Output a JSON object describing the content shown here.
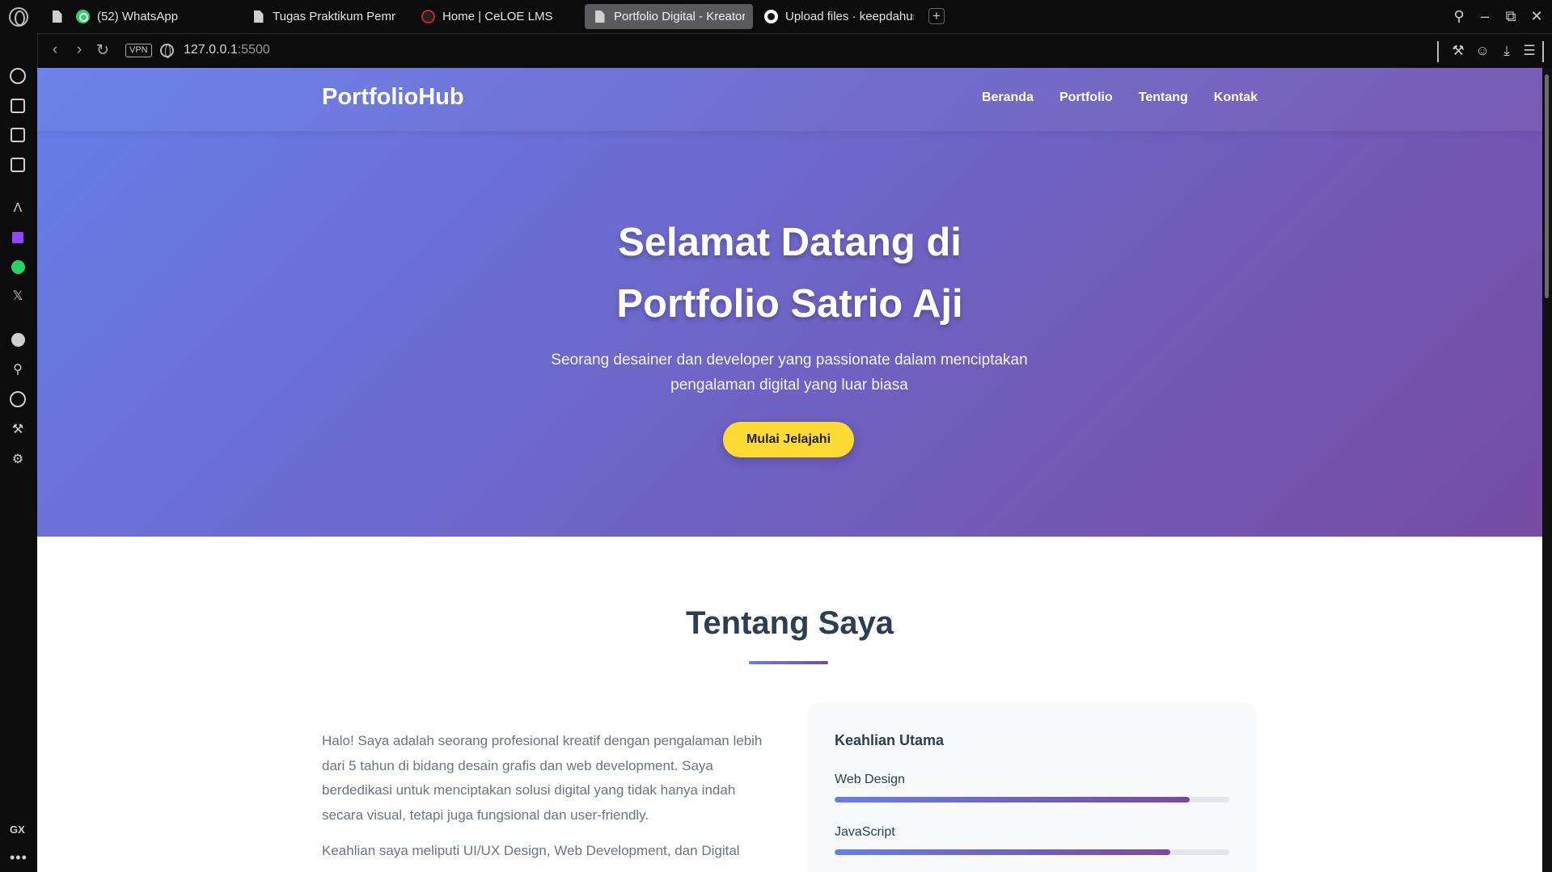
{
  "browser": {
    "tabs": [
      {
        "label": "",
        "icon": "document-icon"
      },
      {
        "label": "(52) WhatsApp",
        "icon": "whatsapp-icon"
      },
      {
        "label": "Tugas Praktikum Pemrog",
        "icon": "document-icon"
      },
      {
        "label": "Home | CeLOE LMS",
        "icon": "celoe-icon"
      },
      {
        "label": "Portfolio Digital - Kreator",
        "icon": "document-icon",
        "active": true
      },
      {
        "label": "Upload files · keepdahust",
        "icon": "github-icon"
      }
    ],
    "new_tab": "+",
    "vpn_label": "VPN",
    "url_host": "127.0.0.1",
    "url_port": ":5500",
    "sidebar_gx": "GX",
    "sidebar_more": "•••"
  },
  "site": {
    "brand": "PortfolioHub",
    "nav": [
      "Beranda",
      "Portfolio",
      "Tentang",
      "Kontak"
    ],
    "hero": {
      "title_line1": "Selamat Datang di",
      "title_line2": "Portfolio Satrio Aji",
      "subtitle": "Seorang desainer dan developer yang passionate dalam menciptakan pengalaman digital yang luar biasa",
      "cta": "Mulai Jelajahi"
    },
    "about": {
      "title": "Tentang Saya",
      "paragraphs": [
        "Halo! Saya adalah seorang profesional kreatif dengan pengalaman lebih dari 5 tahun di bidang desain grafis dan web development. Saya berdedikasi untuk menciptakan solusi digital yang tidak hanya indah secara visual, tetapi juga fungsional dan user-friendly.",
        "Keahlian saya meliputi UI/UX Design, Web Development, dan Digital"
      ]
    },
    "skills": {
      "title": "Keahlian Utama",
      "items": [
        {
          "name": "Web Design",
          "level": 0.9
        },
        {
          "name": "JavaScript",
          "level": 0.85
        }
      ]
    }
  },
  "colors": {
    "hero_gradient_start": "#667eea",
    "hero_gradient_end": "#764ba2",
    "cta_bg": "#fddb33",
    "heading": "#2c3e50"
  }
}
